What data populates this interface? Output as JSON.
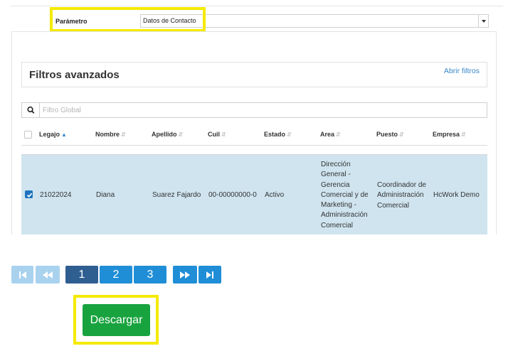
{
  "param": {
    "label": "Parámetro",
    "selected": "Datos de Contacto"
  },
  "filters": {
    "title": "Filtros avanzados",
    "open_link": "Abrir filtros"
  },
  "search": {
    "placeholder": "Filtro Global"
  },
  "table": {
    "columns": [
      {
        "label": "Legajo",
        "sort": "asc"
      },
      {
        "label": "Nombre",
        "sort": "none"
      },
      {
        "label": "Apellido",
        "sort": "none"
      },
      {
        "label": "Cuil",
        "sort": "none"
      },
      {
        "label": "Estado",
        "sort": "none"
      },
      {
        "label": "Area",
        "sort": "none"
      },
      {
        "label": "Puesto",
        "sort": "none"
      },
      {
        "label": "Empresa",
        "sort": "none"
      }
    ],
    "rows": [
      {
        "selected": true,
        "legajo": "21022024",
        "nombre": "Diana",
        "apellido": "Suarez Fajardo",
        "cuil": "00-00000000-0",
        "estado": "Activo",
        "area": [
          "Dirección",
          "General -",
          "Gerencia",
          "Comercial y de",
          "Marketing -",
          "Administración",
          "Comercial"
        ],
        "puesto": [
          "Coordinador de",
          "Administración",
          "Comercial"
        ],
        "empresa": "HcWork Demo"
      }
    ]
  },
  "pagination": {
    "pages": [
      "1",
      "2",
      "3"
    ],
    "current_page": "1",
    "first_enabled": false,
    "prev_enabled": false,
    "next_enabled": true,
    "last_enabled": true
  },
  "download": {
    "label": "Descargar"
  },
  "colors": {
    "highlight": "#f5ea00",
    "download": "#19a33f",
    "page_current": "#2f5e91",
    "page_button": "#1f8ed6",
    "page_disabled": "#a9d2ee",
    "selected_row": "#cfe4ef",
    "link": "#3a87c8"
  }
}
